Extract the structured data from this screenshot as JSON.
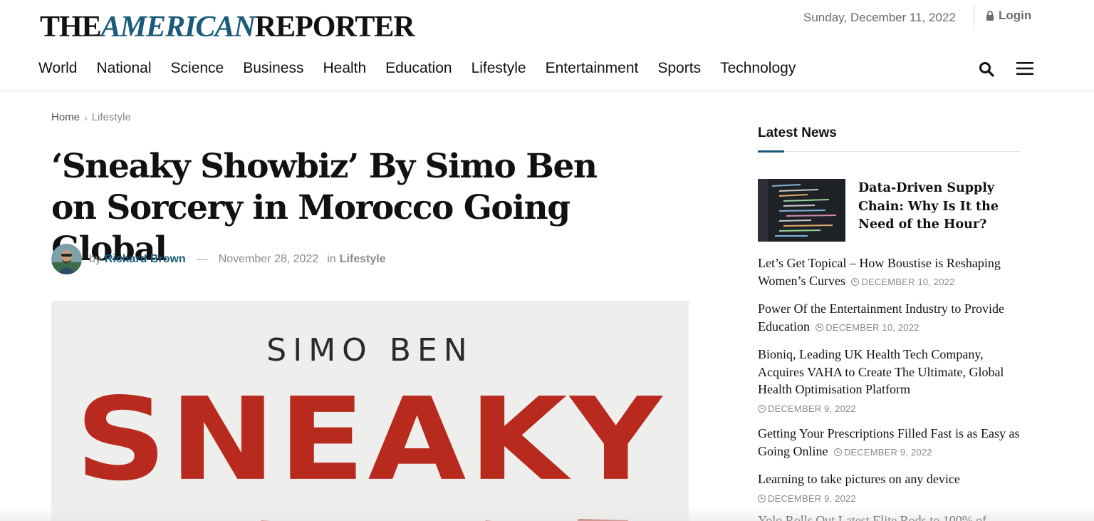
{
  "header": {
    "logo_part1": "THE",
    "logo_part2": "AMERICAN",
    "logo_part3": "REPORTER",
    "date": "Sunday, December 11, 2022",
    "login_label": "Login",
    "nav": [
      "World",
      "National",
      "Science",
      "Business",
      "Health",
      "Education",
      "Lifestyle",
      "Entertainment",
      "Sports",
      "Technology"
    ],
    "icons": {
      "search": "search-icon",
      "menu": "hamburger-menu-icon",
      "login": "lock-icon"
    }
  },
  "breadcrumb": {
    "home": "Home",
    "current": "Lifestyle"
  },
  "article": {
    "title": "‘Sneaky Showbiz’ By Simo Ben on Sorcery in Morocco Going Global",
    "by": "by",
    "author": "Richard Brown",
    "dash": "—",
    "date": "November 28, 2022",
    "in": "in",
    "category": "Lifestyle",
    "hero_author": "SIMO BEN",
    "hero_word": "SNEAKY"
  },
  "sidebar": {
    "title": "Latest News",
    "featured": {
      "title": "Data-Driven Supply Chain: Why Is It the Need of the Hour?"
    },
    "items": [
      {
        "title": "Let’s Get Topical – How Boustise is Reshaping Women’s Curves",
        "date": "DECEMBER 10, 2022"
      },
      {
        "title": "Power Of the Entertainment Industry to Provide Education",
        "date": "DECEMBER 10, 2022"
      },
      {
        "title": "Bioniq, Leading UK Health Tech Company, Acquires VAHA to Create The Ultimate, Global Health Optimisation Platform",
        "date": "DECEMBER 9, 2022"
      },
      {
        "title": "Getting Your Prescriptions Filled Fast is as Easy as Going Online",
        "date": "DECEMBER 9, 2022"
      },
      {
        "title": "Learning to take pictures on any device",
        "date": "DECEMBER 9, 2022"
      }
    ],
    "cut_item": "Yolo Rolls Out Latest Elite Rods to 100% of"
  },
  "colors": {
    "accent": "#1a5a7a",
    "hero_red": "#b82a1e"
  }
}
